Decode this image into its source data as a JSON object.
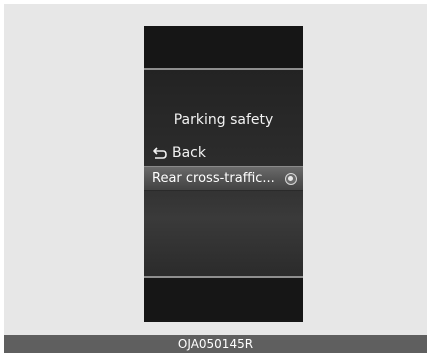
{
  "screen": {
    "title": "Parking safety",
    "back_label": "Back",
    "items": [
      {
        "label": "Rear cross-traffic...",
        "selected": true
      }
    ]
  },
  "caption": "OJA050145R",
  "colors": {
    "background": "#e7e7e7",
    "screen_background": "#1a1a1a",
    "highlight": "#555555",
    "caption_bar": "#5f5f5f",
    "text": "#f2f2f2"
  },
  "icons": {
    "back": "return-arrow-icon",
    "toggle": "radio-icon"
  }
}
